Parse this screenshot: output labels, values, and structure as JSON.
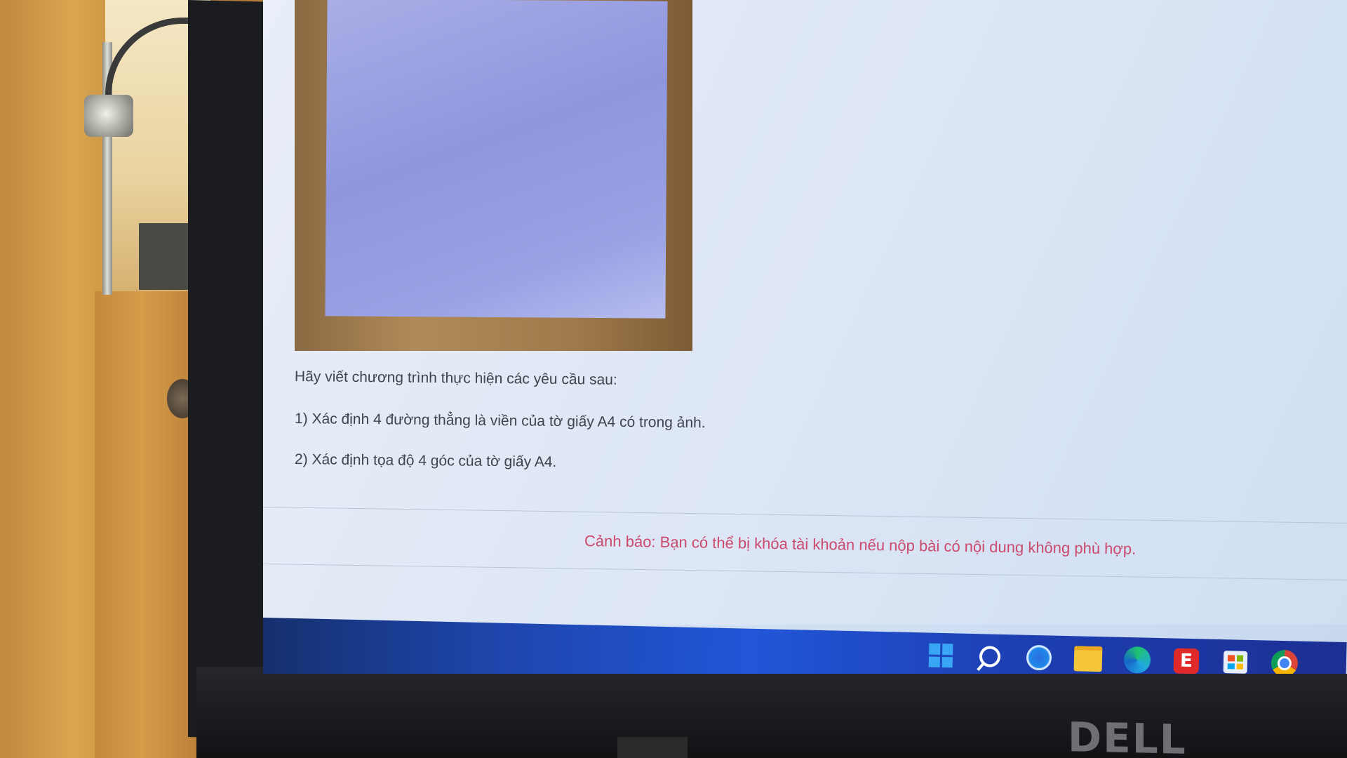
{
  "page": {
    "intro": "Hãy viết chương trình thực hiện các yêu cầu sau:",
    "requirements": [
      "1) Xác định 4 đường thẳng là viền của tờ giấy A4 có trong ảnh.",
      "2) Xác định tọa độ 4 góc của tờ giấy A4."
    ],
    "warning": "Cảnh báo: Bạn có thể bị khóa tài khoản nếu nộp bài có nội dung không phù hợp."
  },
  "taskbar": {
    "icons": [
      "windows-start-icon",
      "search-icon",
      "meet-icon",
      "file-explorer-icon",
      "edge-icon",
      "express-icon",
      "store-icon",
      "chrome-icon"
    ]
  },
  "monitor": {
    "brand": "DELL"
  },
  "colors": {
    "warning": "#cc4a6e",
    "taskbar": "#1d44a8",
    "text": "#3f4450"
  }
}
